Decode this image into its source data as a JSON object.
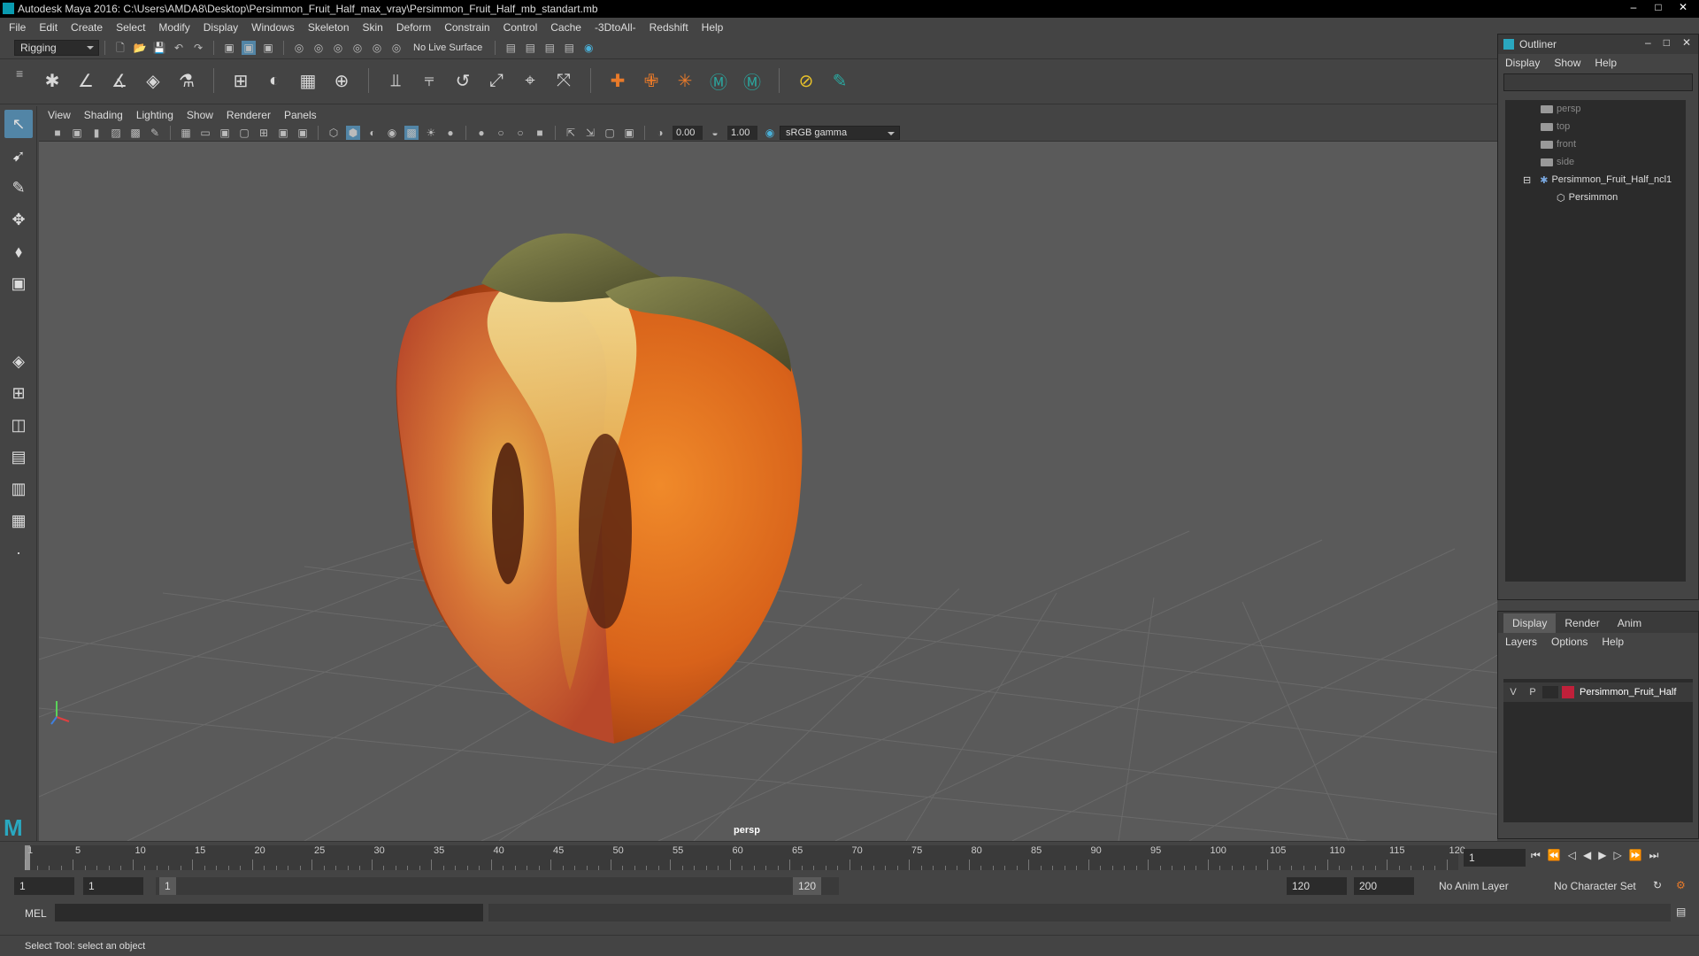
{
  "title_bar": {
    "title": "Autodesk Maya 2016: C:\\Users\\AMDA8\\Desktop\\Persimmon_Fruit_Half_max_vray\\Persimmon_Fruit_Half_mb_standart.mb"
  },
  "menu_bar": [
    "File",
    "Edit",
    "Create",
    "Select",
    "Modify",
    "Display",
    "Windows",
    "Skeleton",
    "Skin",
    "Deform",
    "Constrain",
    "Control",
    "Cache",
    "-3DtoAll-",
    "Redshift",
    "Help"
  ],
  "status_line": {
    "menu_set": "Rigging",
    "live_surface": "No Live Surface"
  },
  "panel_menu": [
    "View",
    "Shading",
    "Lighting",
    "Show",
    "Renderer",
    "Panels"
  ],
  "panel_tools": {
    "exposure": "0.00",
    "gamma": "1.00",
    "color_space": "sRGB gamma"
  },
  "viewport": {
    "camera_label": "persp"
  },
  "outliner": {
    "title": "Outliner",
    "menu": [
      "Display",
      "Show",
      "Help"
    ],
    "items": [
      {
        "label": "persp"
      },
      {
        "label": "top"
      },
      {
        "label": "front"
      },
      {
        "label": "side"
      },
      {
        "label": "Persimmon_Fruit_Half_ncl1"
      },
      {
        "label": "Persimmon"
      }
    ]
  },
  "layer_editor": {
    "tabs": [
      "Display",
      "Render",
      "Anim"
    ],
    "menu": [
      "Layers",
      "Options",
      "Help"
    ],
    "layer": {
      "v": "V",
      "p": "P",
      "name": "Persimmon_Fruit_Half",
      "color": "#c0203a"
    }
  },
  "time_slider": {
    "ticks": [
      "1",
      "5",
      "10",
      "15",
      "20",
      "25",
      "30",
      "35",
      "40",
      "45",
      "50",
      "55",
      "60",
      "65",
      "70",
      "75",
      "80",
      "85",
      "90",
      "95",
      "100",
      "105",
      "110",
      "115",
      "120"
    ],
    "current_frame": "1"
  },
  "range_slider": {
    "start": "1",
    "range_start": "1",
    "slider_start": "1",
    "slider_end": "120",
    "end": "120",
    "max": "200",
    "anim_layer": "No Anim Layer",
    "character_set": "No Character Set"
  },
  "command_line": {
    "label": "MEL"
  },
  "help_line": {
    "text": "Select Tool: select an object"
  }
}
